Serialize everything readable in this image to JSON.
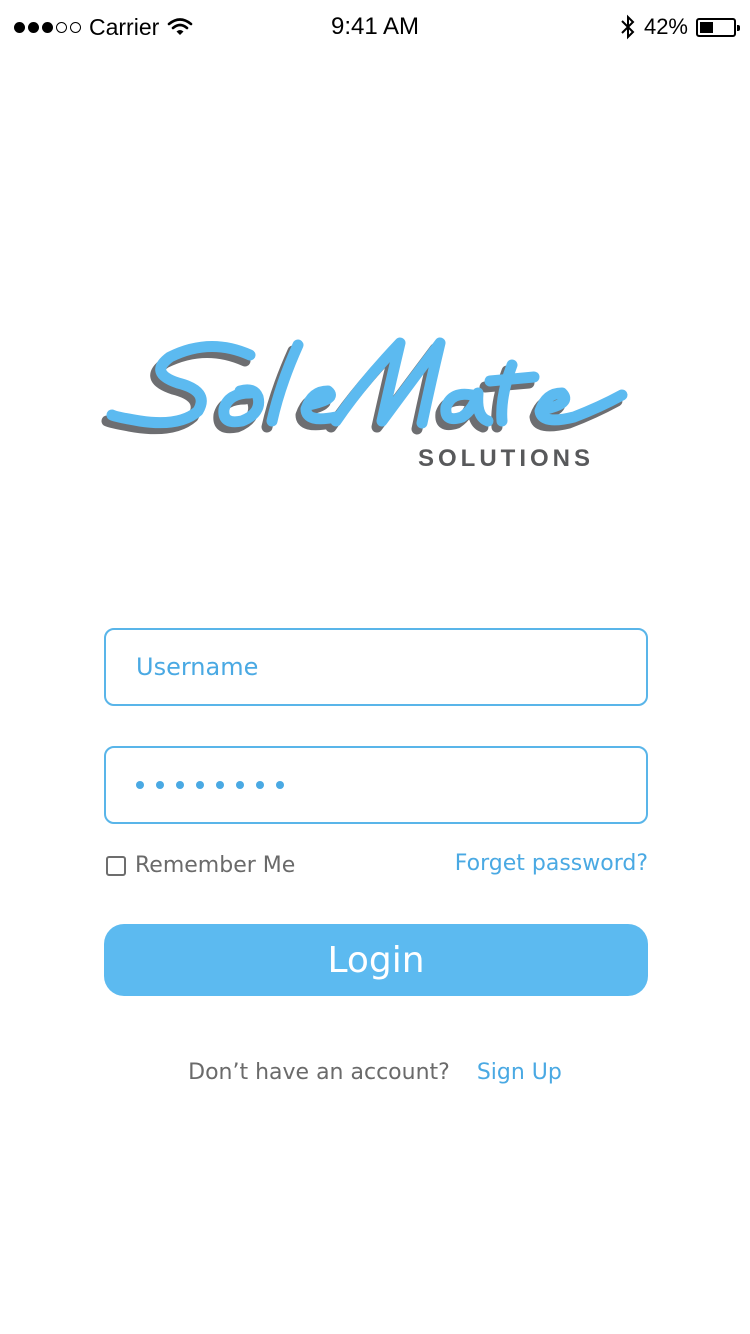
{
  "status_bar": {
    "carrier": "Carrier",
    "time": "9:41 AM",
    "battery_percent": "42%",
    "battery_level": 0.42,
    "signal_dots_filled": 3,
    "signal_dots_total": 5,
    "icons": [
      "wifi-icon",
      "bluetooth-icon",
      "battery-icon"
    ]
  },
  "logo": {
    "script_text": "SoleMate",
    "subtitle": "SOLUTIONS",
    "colors": {
      "primary": "#5cbaf0",
      "shadow": "#6d6e71"
    }
  },
  "form": {
    "username_placeholder": "Username",
    "password_mask_count": 8,
    "remember_label": "Remember Me",
    "remember_checked": false,
    "forgot_label": "Forget password?",
    "login_label": "Login"
  },
  "footer": {
    "question": "Don’t have an account?",
    "signup_label": "Sign Up"
  },
  "colors": {
    "accent": "#5cbaf0",
    "accent_text": "#4aa9e3",
    "muted_text": "#6a6a6a"
  }
}
